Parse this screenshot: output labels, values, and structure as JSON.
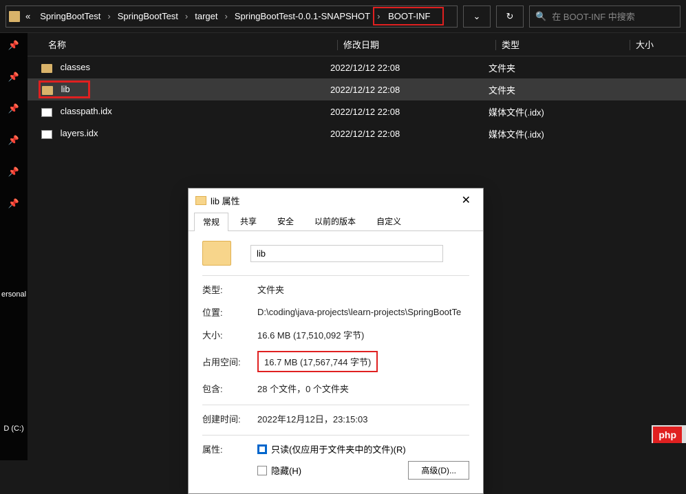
{
  "breadcrumb": {
    "items": [
      "SpringBootTest",
      "SpringBootTest",
      "target",
      "SpringBootTest-0.0.1-SNAPSHOT",
      "BOOT-INF"
    ],
    "prefix": "«"
  },
  "search": {
    "placeholder": "在 BOOT-INF 中搜索"
  },
  "columns": {
    "name": "名称",
    "date": "修改日期",
    "type": "类型",
    "size": "大小"
  },
  "sidebar": {
    "label1": "ersonal",
    "label2": "D (C:)"
  },
  "files": [
    {
      "name": "classes",
      "date": "2022/12/12 22:08",
      "type": "文件夹",
      "icon": "folder",
      "selected": false,
      "box": false
    },
    {
      "name": "lib",
      "date": "2022/12/12 22:08",
      "type": "文件夹",
      "icon": "folder",
      "selected": true,
      "box": true
    },
    {
      "name": "classpath.idx",
      "date": "2022/12/12 22:08",
      "type": "媒体文件(.idx)",
      "icon": "file",
      "selected": false,
      "box": false
    },
    {
      "name": "layers.idx",
      "date": "2022/12/12 22:08",
      "type": "媒体文件(.idx)",
      "icon": "file",
      "selected": false,
      "box": false
    }
  ],
  "dialog": {
    "title": "lib 属性",
    "tabs": [
      "常规",
      "共享",
      "安全",
      "以前的版本",
      "自定义"
    ],
    "name_value": "lib",
    "rows": {
      "type_label": "类型:",
      "type_value": "文件夹",
      "loc_label": "位置:",
      "loc_value": "D:\\coding\\java-projects\\learn-projects\\SpringBootTe",
      "size_label": "大小:",
      "size_value": "16.6 MB (17,510,092 字节)",
      "disk_label": "占用空间:",
      "disk_value": "16.7 MB (17,567,744 字节)",
      "contains_label": "包含:",
      "contains_value": "28 个文件，0 个文件夹",
      "created_label": "创建时间:",
      "created_value": "2022年12月12日，23:15:03",
      "attr_label": "属性:",
      "readonly_label": "只读(仅应用于文件夹中的文件)(R)",
      "hidden_label": "隐藏(H)",
      "advanced_label": "高级(D)..."
    }
  },
  "badge": "php"
}
